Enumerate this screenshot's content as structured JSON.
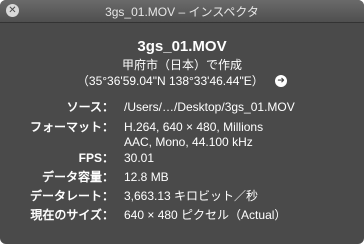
{
  "window": {
    "title": "3gs_01.MOV – インスペクタ"
  },
  "header": {
    "file_name": "3gs_01.MOV",
    "location": "甲府市（日本）で作成",
    "coordinates": "（35°36'59.04\"N 138°33'46.44\"E）"
  },
  "icons": {
    "close": "close-icon",
    "arrow": "arrow-right-circle-icon"
  },
  "info": {
    "source_label": "ソース：",
    "source_value": "/Users/…/Desktop/3gs_01.MOV",
    "format_label": "フォーマット：",
    "format_line1": "H.264, 640 × 480, Millions",
    "format_line2": "AAC, Mono, 44.100 kHz",
    "fps_label": "FPS：",
    "fps_value": "30.01",
    "size_label": "データ容量：",
    "size_value": "12.8 MB",
    "rate_label": "データレート：",
    "rate_value": "3,663.13 キロビット／秒",
    "current_size_label": "現在のサイズ：",
    "current_size_value": "640 × 480 ピクセル（Actual）"
  },
  "colors": {
    "panel": "#444444",
    "text": "#ffffff"
  }
}
